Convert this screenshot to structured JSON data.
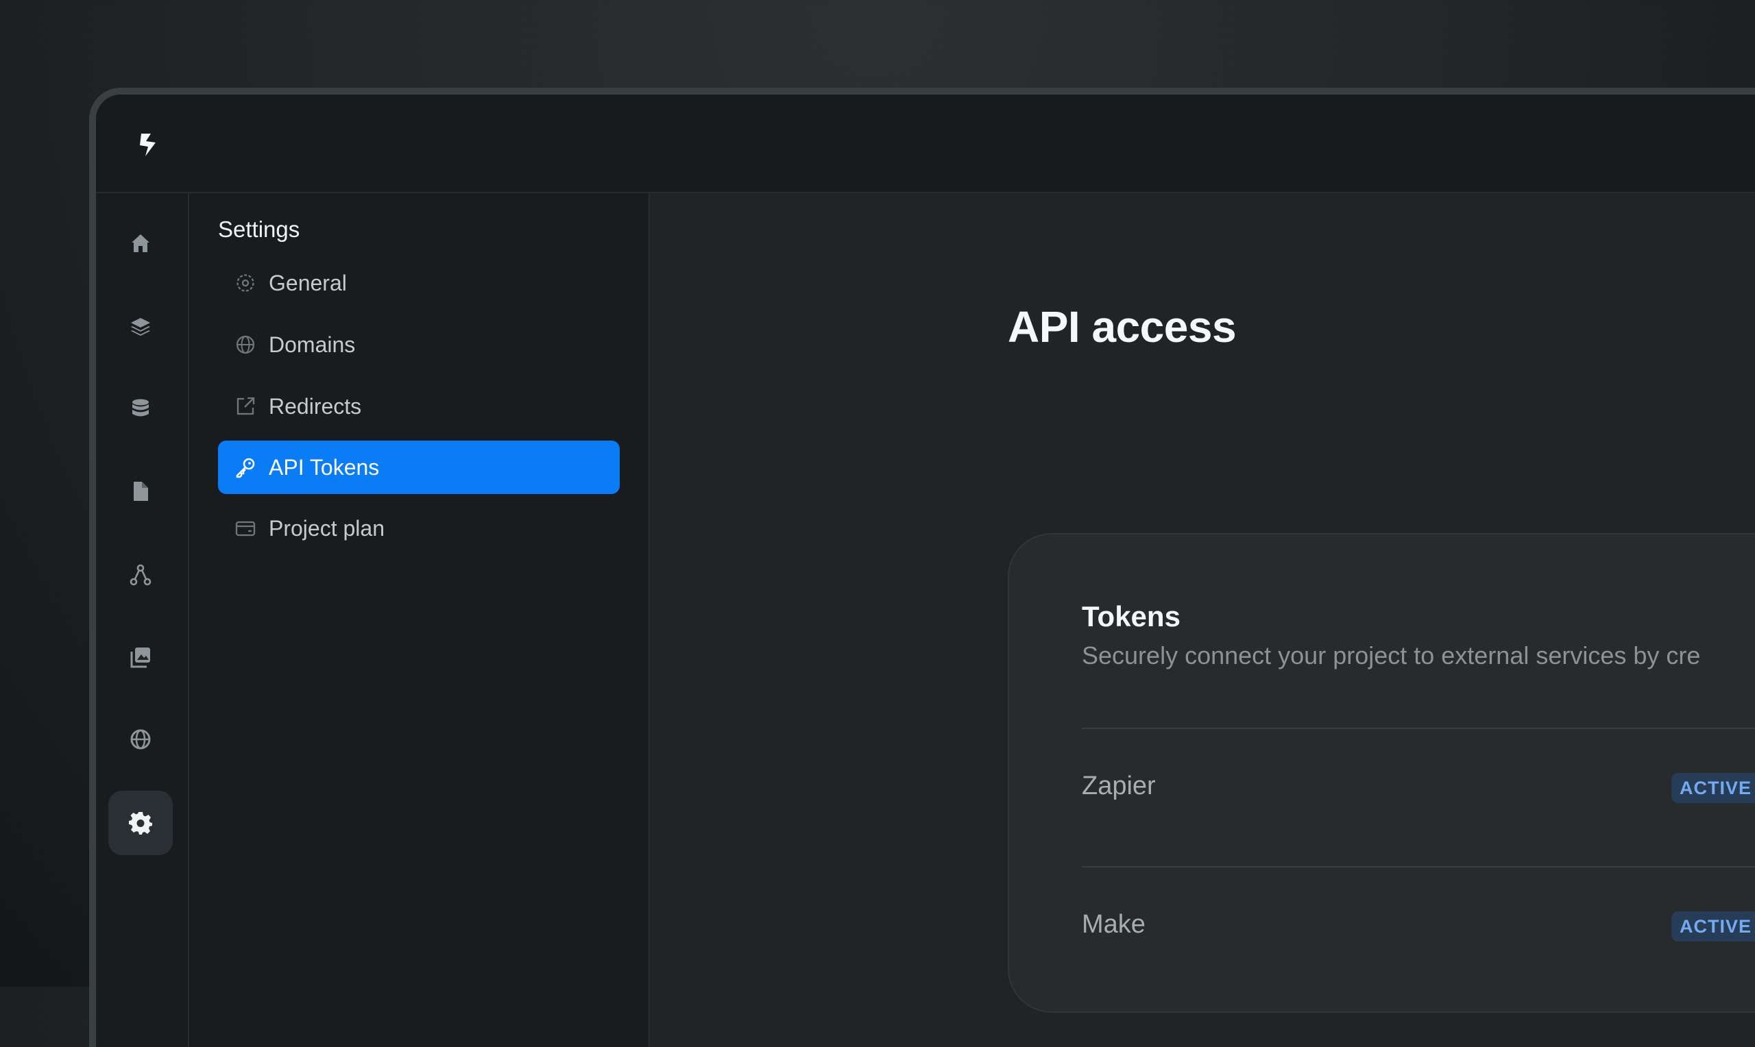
{
  "sidebar": {
    "title": "Settings",
    "items": [
      {
        "label": "General",
        "icon": "gear-outline-icon"
      },
      {
        "label": "Domains",
        "icon": "globe-icon"
      },
      {
        "label": "Redirects",
        "icon": "external-link-icon"
      },
      {
        "label": "API Tokens",
        "icon": "key-icon",
        "active": true
      },
      {
        "label": "Project plan",
        "icon": "credit-card-icon"
      }
    ]
  },
  "rail": {
    "items": [
      {
        "icon": "home-icon"
      },
      {
        "icon": "layers-icon"
      },
      {
        "icon": "database-icon"
      },
      {
        "icon": "file-icon"
      },
      {
        "icon": "workflow-icon"
      },
      {
        "icon": "image-gallery-icon"
      },
      {
        "icon": "globe-icon"
      },
      {
        "icon": "gear-icon",
        "active": true
      }
    ]
  },
  "main": {
    "title": "API access",
    "card": {
      "title": "Tokens",
      "subtitle": "Securely connect your project to external services by cre",
      "tokens": [
        {
          "name": "Zapier",
          "status": "ACTIVE"
        },
        {
          "name": "Make",
          "status": "ACTIVE"
        }
      ]
    }
  },
  "colors": {
    "accent": "#0a7cf5",
    "badge_bg": "#273d57",
    "badge_text": "#73aaf0"
  }
}
